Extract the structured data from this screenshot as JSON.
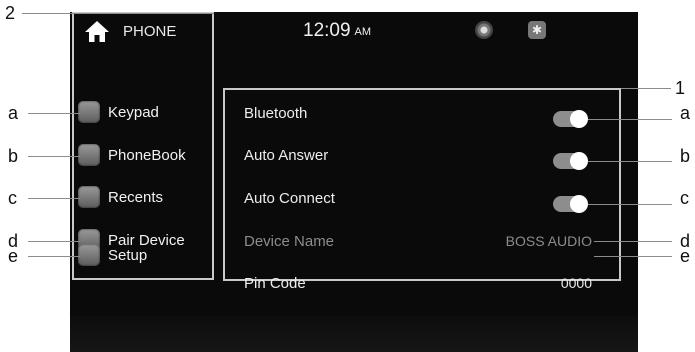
{
  "header": {
    "title": "PHONE",
    "time": "12:09",
    "ampm": "AM",
    "icons": [
      "home-icon",
      "settings-icon",
      "bluetooth-icon"
    ]
  },
  "menu": {
    "items": [
      {
        "label": "Keypad",
        "icon": "keypad-icon"
      },
      {
        "label": "PhoneBook",
        "icon": "phonebook-icon"
      },
      {
        "label": "Recents",
        "icon": "recents-icon"
      },
      {
        "label": "Pair Device",
        "icon": "pair-device-icon"
      },
      {
        "label": "Setup",
        "icon": "setup-icon"
      }
    ]
  },
  "settings": {
    "rows": [
      {
        "label": "Bluetooth",
        "control": "toggle",
        "state": "on"
      },
      {
        "label": "Auto Answer",
        "control": "toggle",
        "state": "on"
      },
      {
        "label": "Auto Connect",
        "control": "toggle",
        "state": "on"
      },
      {
        "label": "Device Name",
        "value": "BOSS AUDIO"
      },
      {
        "label": "Pin Code",
        "value": "0000"
      }
    ]
  },
  "callouts": {
    "group_menu": "2",
    "group_settings": "1",
    "left": [
      "a",
      "b",
      "c",
      "d",
      "e"
    ],
    "right": [
      "a",
      "b",
      "c",
      "d",
      "e"
    ]
  },
  "colors": {
    "screen_bg": "#0a0a0a",
    "frame": "#c9c9c9",
    "toggle_track": "#8d8d8d",
    "toggle_knob": "#ffffff"
  }
}
